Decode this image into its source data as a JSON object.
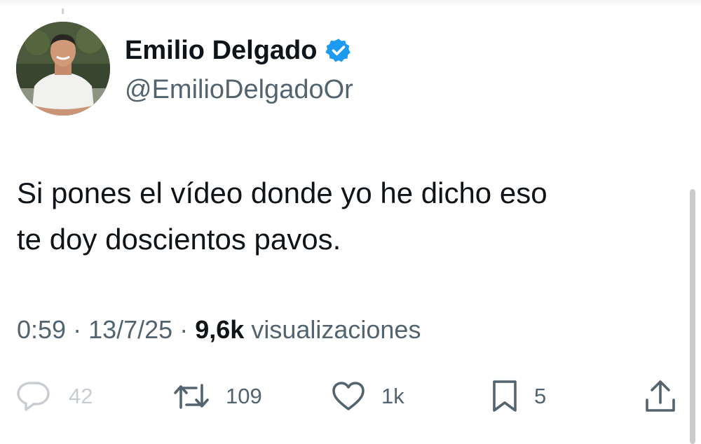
{
  "author": {
    "display_name": "Emilio Delgado",
    "handle": "@EmilioDelgadoOr",
    "verified": true
  },
  "tweet": {
    "text_line1": "Si pones el vídeo donde yo he dicho eso",
    "text_line2": "te doy doscientos pavos."
  },
  "meta": {
    "time": "0:59",
    "separator": "·",
    "date": "13/7/25",
    "views_count": "9,6k",
    "views_label": "visualizaciones"
  },
  "actions": {
    "replies": "42",
    "reposts": "109",
    "likes": "1k",
    "bookmarks": "5"
  },
  "icons": {
    "reply": "reply-icon",
    "repost": "repost-icon",
    "like": "heart-icon",
    "bookmark": "bookmark-icon",
    "share": "share-icon",
    "verified": "verified-badge-icon"
  },
  "colors": {
    "text_primary": "#0f1419",
    "text_secondary": "#536471",
    "verified_blue": "#1d9bf0"
  }
}
